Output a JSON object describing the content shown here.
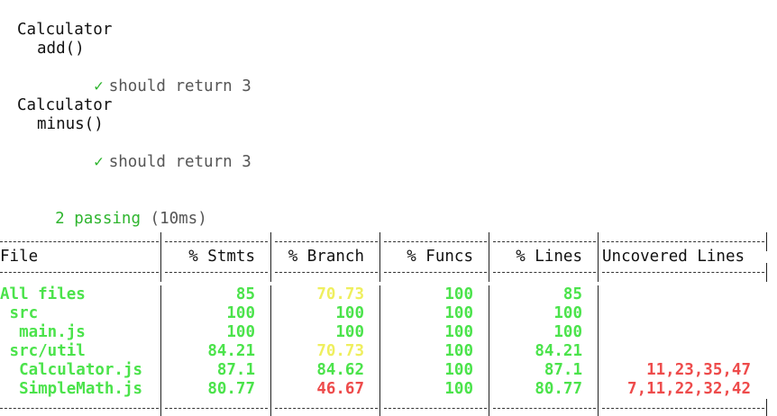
{
  "suites": [
    {
      "suite": "Calculator",
      "method": "add()",
      "check_icon": "check-icon",
      "test": "should return 3"
    },
    {
      "suite": "Calculator",
      "method": "minus()",
      "check_icon": "check-icon",
      "test": "should return 3"
    }
  ],
  "summary": {
    "passing": "2 passing",
    "duration": "(10ms)"
  },
  "coverage": {
    "headers": {
      "file": "File",
      "stmts": "% Stmts",
      "branch": "% Branch",
      "funcs": "% Funcs",
      "lines": "% Lines",
      "uncovered": "Uncovered Lines"
    },
    "rows": [
      {
        "file": "All files",
        "stmts": "85",
        "branch": "70.73",
        "funcs": "100",
        "lines": "85",
        "uncovered": ""
      },
      {
        "file": " src",
        "stmts": "100",
        "branch": "100",
        "funcs": "100",
        "lines": "100",
        "uncovered": ""
      },
      {
        "file": "  main.js",
        "stmts": "100",
        "branch": "100",
        "funcs": "100",
        "lines": "100",
        "uncovered": ""
      },
      {
        "file": " src/util",
        "stmts": "84.21",
        "branch": "70.73",
        "funcs": "100",
        "lines": "84.21",
        "uncovered": ""
      },
      {
        "file": "  Calculator.js",
        "stmts": "87.1",
        "branch": "84.62",
        "funcs": "100",
        "lines": "87.1",
        "uncovered": "11,23,35,47"
      },
      {
        "file": "  SimpleMath.js",
        "stmts": "80.77",
        "branch": "46.67",
        "funcs": "100",
        "lines": "80.77",
        "uncovered": "7,11,22,32,42"
      }
    ],
    "colors": {
      "high": "#4be34b",
      "medium": "#efef5e",
      "low": "#ee4b4b"
    }
  }
}
